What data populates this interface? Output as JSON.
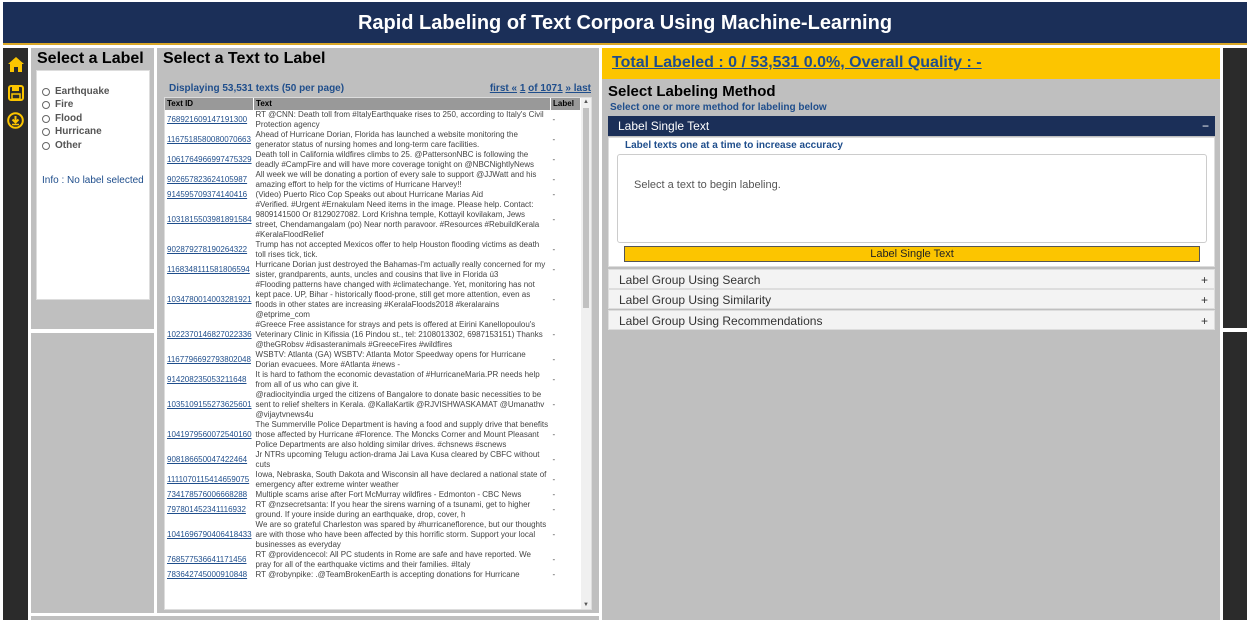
{
  "app": {
    "title": "Rapid Labeling of Text Corpora Using Machine-Learning"
  },
  "icons": [
    "home-icon",
    "save-icon",
    "download-icon"
  ],
  "colors": {
    "header": "#1b2f58",
    "accent": "#fcc500",
    "link": "#1f4e8c"
  },
  "label_panel": {
    "title": "Select a Label",
    "labels": [
      "Earthquake",
      "Fire",
      "Flood",
      "Hurricane",
      "Other"
    ],
    "info": "Info : No label selected"
  },
  "text_panel": {
    "title": "Select a Text to Label",
    "displaying": "Displaying 53,531 texts (50 per page)",
    "pager": {
      "first": "first «",
      "page": "1",
      "of": "of 1071",
      "last": "» last"
    },
    "columns": [
      "Text ID",
      "Text",
      "Label"
    ],
    "rows": [
      {
        "id": "768921609147191300",
        "text": "RT @CNN: Death toll from #ItalyEarthquake rises to 250, according to Italy's Civil Protection agency",
        "label": "-"
      },
      {
        "id": "1167518580080070663",
        "text": "Ahead of Hurricane Dorian, Florida has launched a website monitoring the generator status of nursing homes and long-term care facilities.",
        "label": "-"
      },
      {
        "id": "1061764966997475329",
        "text": "Death toll in California wildfires climbs to 25. @PattersonNBC is following the deadly #CampFire and will have more coverage tonight on @NBCNightlyNews",
        "label": "-"
      },
      {
        "id": "902657823624105987",
        "text": "All week we will be donating a portion of every sale to support @JJWatt and his amazing effort to help for the victims of Hurricane Harvey!!",
        "label": "-"
      },
      {
        "id": "914595709374140416",
        "text": "(Video) Puerto Rico Cop Speaks out about Hurricane Marias Aid",
        "label": "-"
      },
      {
        "id": "1031815503981891584",
        "text": "#Verified. #Urgent #Ernakulam Need items in the image. Please help. Contact: 9809141500 Or 8129027082. Lord Krishna temple, Kottayil kovilakam, Jews street, Chendamangalam (po) Near north paravoor. #Resources #RebuildKerala #KeralaFloodRelief",
        "label": "-"
      },
      {
        "id": "902879278190264322",
        "text": "Trump has not accepted Mexicos offer to help Houston flooding victims as death toll rises tick, tick.",
        "label": "-"
      },
      {
        "id": "1168348111581806594",
        "text": "Hurricane Dorian just destroyed the Bahamas-I'm actually really concerned for my sister, grandparents, aunts, uncles and cousins that live in Florida ú3",
        "label": "-"
      },
      {
        "id": "1034780014003281921",
        "text": "#Flooding patterns have changed with #climatechange. Yet, monitoring has not kept pace. UP, Bihar - historically flood-prone, still get more attention, even as floods in other states are increasing #KeralaFloods2018 #keralarains @etprime_com",
        "label": "-"
      },
      {
        "id": "1022370146827022336",
        "text": "#Greece Free assistance for strays and pets is offered at Eirini Kanellopoulou's Veterinary Clinic in Kifissia (16 Pindou st., tel: 2108013302, 6987153151) Thanks @theGRobsv #disasteranimals #GreeceFires #wildfires",
        "label": "-"
      },
      {
        "id": "1167796692793802048",
        "text": "WSBTV: Atlanta (GA) WSBTV: Atlanta Motor Speedway opens for Hurricane Dorian evacuees. More #Atlanta #news -",
        "label": "-"
      },
      {
        "id": "914208235053211648",
        "text": "It is hard to fathom the economic devastation of #HurricaneMaria.PR needs help from all of us who can give it.",
        "label": "-"
      },
      {
        "id": "1035109155273625601",
        "text": "@radiocityindia urged the citizens of Bangalore to donate basic necessities to be sent to relief shelters in Kerala. @KallaKartik @RJVISHWASKAMAT @Umanathv @vijaytvnews4u",
        "label": "-"
      },
      {
        "id": "1041979560072540160",
        "text": "The Summerville Police Department is having a food and supply drive that benefits those affected by Hurricane #Florence. The Moncks Corner and Mount Pleasant Police Departments are also holding similar drives. #chsnews #scnews",
        "label": "-"
      },
      {
        "id": "908186650047422464",
        "text": "Jr NTRs upcoming Telugu action-drama Jai Lava Kusa cleared by CBFC without cuts",
        "label": "-"
      },
      {
        "id": "1111070115414659075",
        "text": "Iowa, Nebraska, South Dakota and Wisconsin all have declared a national state of emergency after extreme winter weather",
        "label": "-"
      },
      {
        "id": "734178576006668288",
        "text": "Multiple scams arise after Fort McMurray wildfires - Edmonton - CBC News",
        "label": "-"
      },
      {
        "id": "797801452341116932",
        "text": "RT @nzsecretsanta: If you hear the sirens warning of a tsunami, get to higher ground. If youre inside during an earthquake, drop, cover, h",
        "label": "-"
      },
      {
        "id": "1041696790406418433",
        "text": "We are so grateful Charleston was spared by #hurricaneflorence, but our thoughts are with those who have been affected by this horrific storm. Support your local businesses as everyday",
        "label": "-"
      },
      {
        "id": "768577536641171456",
        "text": "RT @providencecol: All PC students in Rome are safe and have reported. We pray for all of the earthquake victims and their families. #Italy",
        "label": "-"
      },
      {
        "id": "783642745000910848",
        "text": "RT @robynpike: .@TeamBrokenEarth is accepting donations for Hurricane",
        "label": "-"
      }
    ]
  },
  "summary": {
    "total": "Total Labeled : 0 / 53,531 0.0%, Overall Quality : -"
  },
  "method_panel": {
    "title": "Select Labeling Method",
    "subtitle": "Select one or more method for labeling below",
    "single": {
      "header": "Label Single Text",
      "sign": "−",
      "desc": "Label texts one at a time to increase accuracy",
      "placeholder": "Select a text to begin labeling.",
      "button": "Label Single Text"
    },
    "others": [
      {
        "header": "Label Group Using Search",
        "sign": "+"
      },
      {
        "header": "Label Group Using Similarity",
        "sign": "+"
      },
      {
        "header": "Label Group Using Recommendations",
        "sign": "+"
      }
    ]
  }
}
